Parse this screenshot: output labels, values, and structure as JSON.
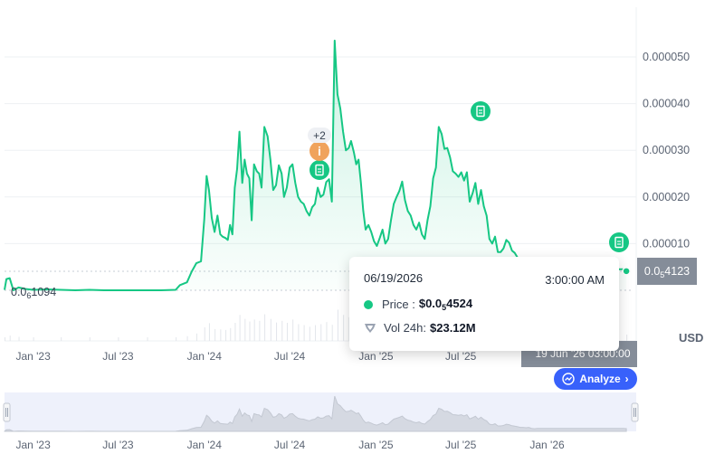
{
  "chart_data": {
    "type": "line",
    "currency": "USD",
    "y_ticks": [
      "0.000010",
      "0.000020",
      "0.000030",
      "0.000040",
      "0.000050"
    ],
    "ylim": [
      0,
      5.5e-05
    ],
    "x_ticks": [
      "Jan '23",
      "Jul '23",
      "Jan '24",
      "Jul '24",
      "Jan '25",
      "Jul '25"
    ],
    "navigator_x_ticks": [
      "Jan '23",
      "Jul '23",
      "Jan '24",
      "Jul '24",
      "Jan '25",
      "Jul '25",
      "Jan '26"
    ],
    "first_price_label": {
      "prefix": "0.0",
      "zeros": "6",
      "digits": "1094"
    },
    "last_price_label": {
      "prefix": "0.0",
      "zeros": "5",
      "digits": "4123"
    },
    "series": [
      {
        "x": [
          "2022-11-01",
          "2022-11-05",
          "2022-11-12",
          "2022-11-20",
          "2022-12-01",
          "2022-12-15",
          "2023-01-01",
          "2023-02-01",
          "2023-03-01",
          "2023-04-01",
          "2023-05-01",
          "2023-06-01",
          "2023-07-01",
          "2023-08-01",
          "2023-09-01",
          "2023-10-01",
          "2023-11-01",
          "2023-11-10",
          "2023-11-25",
          "2023-12-05",
          "2023-12-15",
          "2023-12-25",
          "2024-01-01",
          "2024-01-06",
          "2024-01-11",
          "2024-01-17",
          "2024-01-23",
          "2024-01-29",
          "2024-02-04",
          "2024-02-09",
          "2024-02-15",
          "2024-02-20",
          "2024-02-25",
          "2024-03-01",
          "2024-03-06",
          "2024-03-11",
          "2024-03-16",
          "2024-03-22",
          "2024-03-27",
          "2024-04-01",
          "2024-04-06",
          "2024-04-11",
          "2024-04-16",
          "2024-04-22",
          "2024-04-27",
          "2024-05-02",
          "2024-05-08",
          "2024-05-15",
          "2024-05-21",
          "2024-05-27",
          "2024-06-02",
          "2024-06-08",
          "2024-06-14",
          "2024-06-19",
          "2024-06-25",
          "2024-07-01",
          "2024-07-07",
          "2024-07-13",
          "2024-07-19",
          "2024-07-25",
          "2024-07-31",
          "2024-08-06",
          "2024-08-12",
          "2024-08-18",
          "2024-08-24",
          "2024-08-30",
          "2024-09-05",
          "2024-09-11",
          "2024-09-17",
          "2024-09-23",
          "2024-09-29",
          "2024-10-05",
          "2024-10-11",
          "2024-10-17",
          "2024-10-23",
          "2024-10-29",
          "2024-11-04",
          "2024-11-09",
          "2024-11-15",
          "2024-11-20",
          "2024-11-25",
          "2024-11-30",
          "2024-12-05",
          "2024-12-10",
          "2024-12-16",
          "2024-12-22",
          "2024-12-28",
          "2025-01-03",
          "2025-01-09",
          "2025-01-15",
          "2025-01-21",
          "2025-01-27",
          "2025-02-02",
          "2025-02-08",
          "2025-02-14",
          "2025-02-20",
          "2025-02-26",
          "2025-03-04",
          "2025-03-10",
          "2025-03-16",
          "2025-03-22",
          "2025-03-28",
          "2025-04-03",
          "2025-04-09",
          "2025-04-15",
          "2025-04-21",
          "2025-04-27",
          "2025-05-03",
          "2025-05-09",
          "2025-05-15",
          "2025-05-21",
          "2025-05-27",
          "2025-06-02",
          "2025-06-08",
          "2025-06-14",
          "2025-06-20",
          "2025-06-26",
          "2025-07-02",
          "2025-07-08",
          "2025-07-14",
          "2025-07-20",
          "2025-07-26",
          "2025-08-01",
          "2025-08-07",
          "2025-08-13",
          "2025-08-19",
          "2025-08-25",
          "2025-08-31",
          "2025-09-06",
          "2025-09-12",
          "2025-09-18",
          "2025-09-24",
          "2025-09-30",
          "2025-10-06",
          "2025-10-12",
          "2025-10-18",
          "2025-10-24",
          "2025-10-30",
          "2025-11-05",
          "2025-11-11",
          "2025-11-17",
          "2025-11-23",
          "2025-11-29",
          "2025-12-05",
          "2025-12-11",
          "2025-12-17",
          "2025-12-23",
          "2025-12-29",
          "2026-01-04",
          "2026-01-10",
          "2026-01-18",
          "2026-01-25",
          "2026-02-01",
          "2026-06-12",
          "2026-06-19"
        ],
        "y": [
          1e-07,
          2.4e-06,
          2.6e-06,
          0.0,
          6e-07,
          3e-07,
          1e-07,
          2e-07,
          1e-07,
          0.0,
          1e-07,
          0.0,
          0.0,
          0.0,
          0.0,
          0.0,
          1e-07,
          1.1e-06,
          1.7e-06,
          4e-06,
          5.8e-06,
          6.2e-06,
          1.52e-05,
          2.45e-05,
          2.15e-05,
          1.55e-05,
          1.25e-05,
          1.6e-05,
          1.2e-05,
          1.15e-05,
          1.12e-05,
          1.08e-05,
          1.4e-05,
          1.2e-05,
          2.2e-05,
          2.6e-05,
          3.4e-05,
          2.3e-05,
          2.8e-05,
          2.5e-05,
          2.4e-05,
          1.5e-05,
          2.7e-05,
          2.55e-05,
          2.5e-05,
          2.2e-05,
          3.5e-05,
          3.3e-05,
          2.8e-05,
          2.15e-05,
          2.25e-05,
          2.68e-05,
          2.5e-05,
          2e-05,
          2.2e-05,
          2.63e-05,
          2.7e-05,
          2.3e-05,
          2e-05,
          1.9e-05,
          1.85e-05,
          1.7e-05,
          1.6e-05,
          1.78e-05,
          1.85e-05,
          2.2e-05,
          2e-05,
          2.05e-05,
          2.32e-05,
          2.38e-05,
          1.9e-05,
          5.35e-05,
          4.2e-05,
          3.9e-05,
          3.4e-05,
          3e-05,
          3.05e-05,
          3.2e-05,
          2.95e-05,
          2.7e-05,
          2.8e-05,
          2.3e-05,
          1.7e-05,
          1.3e-05,
          1.4e-05,
          1.25e-05,
          1.05e-05,
          9.5e-06,
          1.12e-05,
          1.3e-05,
          1e-05,
          1.1e-05,
          1.5e-05,
          1.85e-05,
          2e-05,
          2.13e-05,
          2.33e-05,
          1.93e-05,
          1.7e-05,
          1.6e-05,
          1.4e-05,
          1.3e-05,
          1.45e-05,
          1.2e-05,
          1.1e-05,
          1.5e-05,
          1.8e-05,
          2.4e-05,
          2.63e-05,
          3.5e-05,
          3.35e-05,
          3.03e-05,
          3.05e-05,
          2.85e-05,
          2.55e-05,
          2.5e-05,
          2.43e-05,
          2.53e-05,
          2.35e-05,
          2.53e-05,
          1.9e-05,
          2.08e-05,
          2.3e-05,
          1.85e-05,
          2.15e-05,
          1.8e-05,
          1.6e-05,
          1.1e-05,
          1e-05,
          1.15e-05,
          8.2e-06,
          8.2e-06,
          9e-06,
          1.08e-05,
          1.02e-05,
          8.5e-06,
          8e-06,
          7e-06,
          6e-06,
          6e-06,
          5.5e-06,
          6e-06,
          4.5e-06,
          4e-06,
          4.5e-06,
          4.5e-06,
          4.5e-06,
          4.5e-06,
          4.5e-06,
          4.5e-06,
          4.5e-06,
          4.5e-06,
          4.5e-06,
          4.5e-06,
          4.1e-06
        ]
      }
    ],
    "annotations": [
      {
        "date": "2024-10-01",
        "kind": "news",
        "badge": "+2"
      },
      {
        "date": "2024-10-01",
        "kind": "info"
      },
      {
        "date": "2025-08-15",
        "kind": "news"
      },
      {
        "date": "2026-06-12",
        "kind": "news"
      }
    ],
    "tooltip": {
      "date": "06/19/2026",
      "time": "3:00:00 AM",
      "price_label": "Price :",
      "price_prefix": "$0.0",
      "price_zeros": "5",
      "price_digits": "4524",
      "vol_label": "Vol 24h:",
      "vol_value": "$23.12M"
    },
    "crosshair_time": "19 Jun '26 03:00:00",
    "analyze_label": "Analyze",
    "grid": true,
    "colors": {
      "line": "#16c784",
      "fill": "#16c784",
      "news": "#16c784",
      "info": "#f0a35c",
      "button": "#3861fb",
      "badge_bg": "#858d99"
    }
  }
}
